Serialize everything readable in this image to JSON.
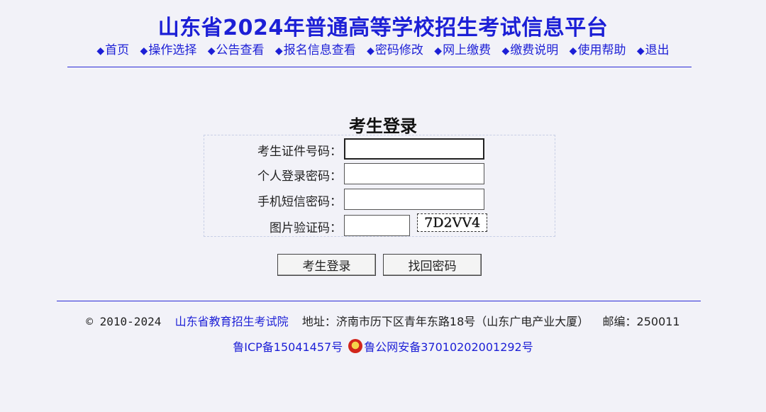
{
  "header": {
    "title": "山东省2024年普通高等学校招生考试信息平台"
  },
  "nav": {
    "items": [
      {
        "label": "首页"
      },
      {
        "label": "操作选择"
      },
      {
        "label": "公告查看"
      },
      {
        "label": "报名信息查看"
      },
      {
        "label": "密码修改"
      },
      {
        "label": "网上缴费"
      },
      {
        "label": "缴费说明"
      },
      {
        "label": "使用帮助"
      },
      {
        "label": "退出"
      }
    ],
    "bullet": "◆"
  },
  "login": {
    "title": "考生登录",
    "fields": {
      "id_label": "考生证件号码：",
      "id_value": "",
      "password_label": "个人登录密码：",
      "password_value": "",
      "sms_label": "手机短信密码：",
      "sms_value": "",
      "captcha_label": "图片验证码：",
      "captcha_value": "",
      "captcha_image_text": "7D2VV4"
    },
    "buttons": {
      "login": "考生登录",
      "recover": "找回密码"
    }
  },
  "footer": {
    "copyright": "© 2010-2024",
    "org": "山东省教育招生考试院",
    "address": "地址：济南市历下区青年东路18号（山东广电产业大厦）",
    "postcode": "邮编：250011",
    "icp": "鲁ICP备15041457号",
    "police": "鲁公网安备37010202001292号"
  },
  "colors": {
    "accent": "#1c1fd6",
    "background": "#f2f2f8"
  }
}
